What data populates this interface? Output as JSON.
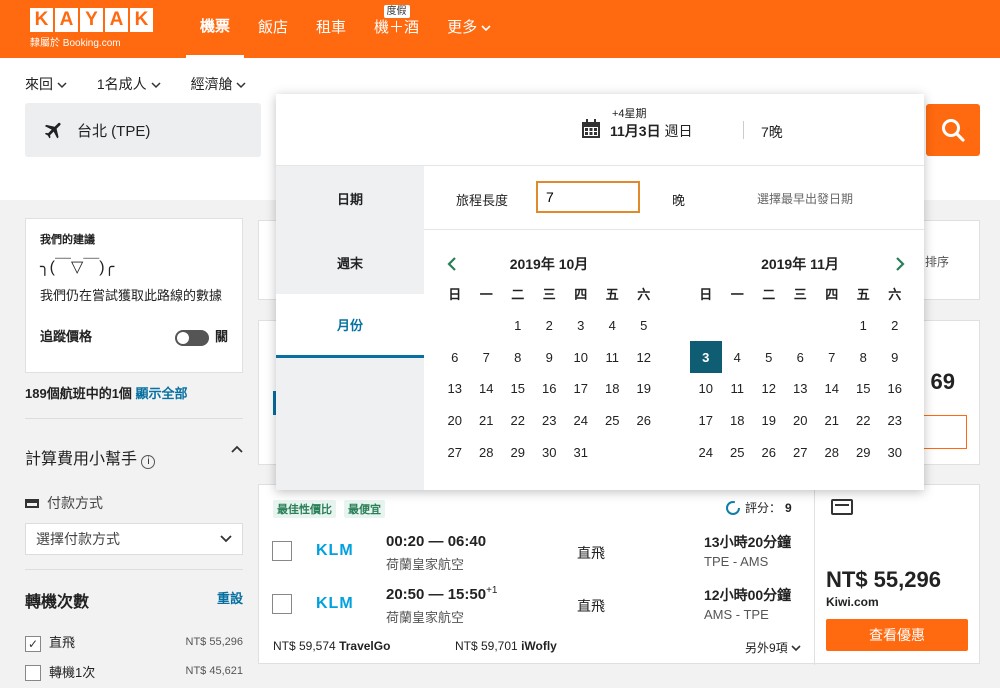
{
  "brand": {
    "letters": [
      "K",
      "A",
      "Y",
      "A",
      "K"
    ],
    "sub": "隸屬於 Booking.com"
  },
  "nav": [
    {
      "label": "機票"
    },
    {
      "label": "飯店"
    },
    {
      "label": "租車"
    },
    {
      "label": "機＋酒",
      "badge": "度假"
    },
    {
      "label": "更多"
    }
  ],
  "search": {
    "trip_type": "來回",
    "travelers": "1名成人",
    "cabin": "經濟艙",
    "origin": "台北 (TPE)"
  },
  "popup": {
    "plus": "+4星期",
    "date_label": "11月3日",
    "date_day": "週日",
    "nights": "7晚",
    "tabs": [
      "日期",
      "週末",
      "月份"
    ],
    "trip_length_label": "旅程長度",
    "trip_length_value": "7",
    "nights_unit": "晚",
    "earliest_hint": "選擇最早出發日期",
    "weekdays": [
      "日",
      "一",
      "二",
      "三",
      "四",
      "五",
      "六"
    ],
    "months": [
      {
        "title": "2019年 10月",
        "offset": 2,
        "days": 31,
        "selected": null
      },
      {
        "title": "2019年 11月",
        "offset": 5,
        "days": 30,
        "selected": 3
      }
    ]
  },
  "sidebar": {
    "sugg_title": "我們的建議",
    "sugg_face": "╮(￣▽￣)╭",
    "sugg_text": "我們仍在嘗試獲取此路線的數據",
    "track_label": "追蹤價格",
    "track_state": "關",
    "count_text": "189個航班中的1個",
    "show_all": "顯示全部",
    "fee_title": "計算費用小幫手",
    "pay_label": "付款方式",
    "pay_select": "選擇付款方式",
    "stops_title": "轉機次數",
    "reset": "重設",
    "stops": [
      {
        "label": "直飛",
        "price": "NT$ 55,296",
        "checked": true
      },
      {
        "label": "轉機1次",
        "price": "NT$ 45,621",
        "checked": false
      }
    ]
  },
  "right_peek": {
    "sort": "排序",
    "price_frag": "69"
  },
  "result": {
    "tags": [
      "最佳性價比",
      "最便宜"
    ],
    "score_label": "評分：",
    "score": "9",
    "legs": [
      {
        "airline_logo": "KLM",
        "times": "00:20 — 06:40",
        "plus": "",
        "airline": "荷蘭皇家航空",
        "stops": "直飛",
        "duration": "13小時20分鐘",
        "route": "TPE - AMS"
      },
      {
        "airline_logo": "KLM",
        "times": "20:50 — 15:50",
        "plus": "+1",
        "airline": "荷蘭皇家航空",
        "stops": "直飛",
        "duration": "12小時00分鐘",
        "route": "AMS - TPE"
      }
    ],
    "alts": [
      {
        "price": "NT$ 59,574",
        "site": "TravelGo"
      },
      {
        "price": "NT$ 59,701",
        "site": "iWofly"
      }
    ],
    "more": "另外9項",
    "price": "NT$ 55,296",
    "provider": "Kiwi.com",
    "cta": "查看優惠"
  }
}
